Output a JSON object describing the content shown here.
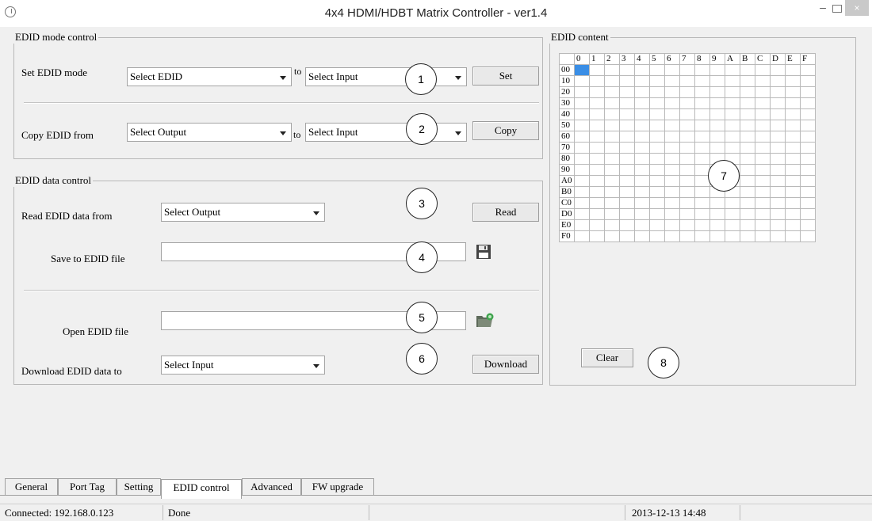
{
  "window": {
    "title": "4x4 HDMI/HDBT Matrix Controller - ver1.4",
    "minimize": "–",
    "close": "×"
  },
  "edid_mode": {
    "legend": "EDID mode control",
    "set_label": "Set EDID mode",
    "set_combo": "Select EDID",
    "to1": "to",
    "set_target_combo": "Select Input",
    "set_button": "Set",
    "copy_label": "Copy EDID from",
    "copy_combo": "Select Output",
    "to2": "to",
    "copy_target_combo": "Select Input",
    "copy_button": "Copy"
  },
  "edid_data": {
    "legend": "EDID data control",
    "read_label": "Read EDID data from",
    "read_combo": "Select Output",
    "read_button": "Read",
    "save_label": "Save to EDID file",
    "save_value": "",
    "open_label": "Open EDID file",
    "open_value": "",
    "download_label": "Download EDID data to",
    "download_combo": "Select Input",
    "download_button": "Download"
  },
  "edid_content": {
    "legend": "EDID content",
    "columns": [
      "0",
      "1",
      "2",
      "3",
      "4",
      "5",
      "6",
      "7",
      "8",
      "9",
      "A",
      "B",
      "C",
      "D",
      "E",
      "F"
    ],
    "rows": [
      "00",
      "10",
      "20",
      "30",
      "40",
      "50",
      "60",
      "70",
      "80",
      "90",
      "A0",
      "B0",
      "C0",
      "D0",
      "E0",
      "F0"
    ],
    "clear_button": "Clear"
  },
  "callouts": [
    "1",
    "2",
    "3",
    "4",
    "5",
    "6",
    "7",
    "8"
  ],
  "tabs": [
    "General",
    "Port Tag",
    "Setting",
    "EDID control",
    "Advanced",
    "FW upgrade"
  ],
  "active_tab": "EDID control",
  "status": {
    "connection": "Connected: 192.168.0.123",
    "message": "Done",
    "datetime": "2013-12-13 14:48"
  },
  "icons": {
    "save": "floppy-disk-icon",
    "open": "open-folder-icon"
  },
  "colors": {
    "selection": "#3a8ee6"
  }
}
